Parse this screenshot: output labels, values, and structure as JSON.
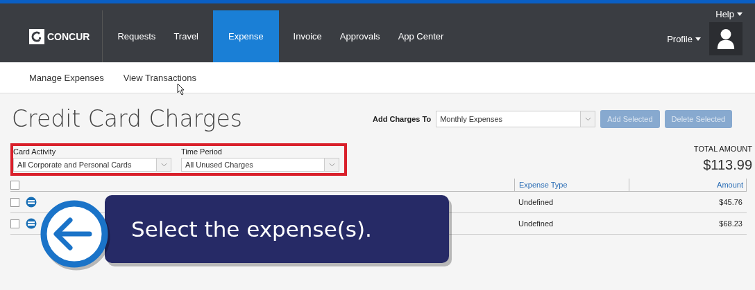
{
  "navbar": {
    "logo": "CONCUR",
    "items": [
      {
        "label": "Requests",
        "selected": false
      },
      {
        "label": "Travel",
        "selected": false
      },
      {
        "label": "Expense",
        "selected": true
      },
      {
        "label": "Invoice",
        "selected": false
      },
      {
        "label": "Approvals",
        "selected": false
      },
      {
        "label": "App Center",
        "selected": false
      }
    ],
    "help": "Help",
    "profile": "Profile"
  },
  "subnav": [
    "Manage Expenses",
    "View Transactions"
  ],
  "title": "Credit Card Charges",
  "add_charges": {
    "label": "Add Charges To",
    "value": "Monthly Expenses",
    "buttons": [
      {
        "label": "Add Selected",
        "disabled": true
      },
      {
        "label": "Delete Selected",
        "disabled": true
      }
    ]
  },
  "filters": [
    {
      "label": "Card Activity",
      "value": "All Corporate and Personal Cards"
    },
    {
      "label": "Time Period",
      "value": "All Unused Charges"
    }
  ],
  "total": {
    "label": "TOTAL AMOUNT",
    "value": "$113.99"
  },
  "table": {
    "select_all_checked": false,
    "columns": [
      "Expense Type",
      "Amount"
    ],
    "rows": [
      {
        "checked": false,
        "expense_type": "Undefined",
        "amount": "$45.76"
      },
      {
        "checked": false,
        "expense_type": "Undefined",
        "amount": "$68.23"
      }
    ]
  },
  "callout": {
    "text": "Select the expense(s)."
  }
}
